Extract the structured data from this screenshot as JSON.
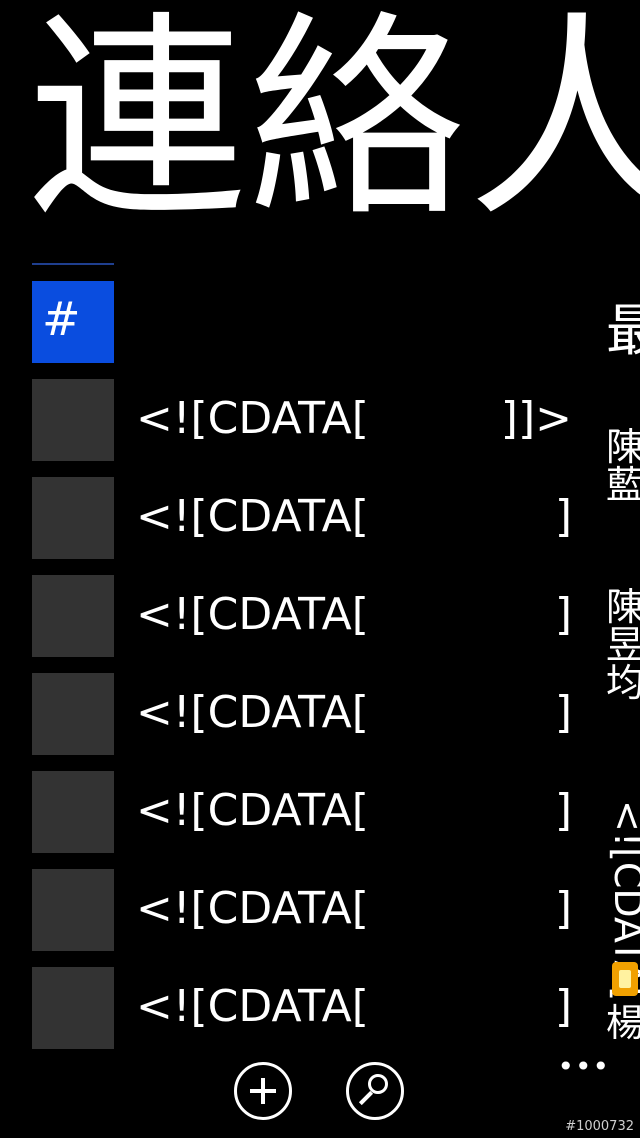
{
  "page": {
    "title": "連絡人"
  },
  "jump_list": {
    "header_tile": "#",
    "rows": [
      {
        "label": "<![CDATA[",
        "tail": "]]>"
      },
      {
        "label": "<![CDATA[",
        "tail": "]"
      },
      {
        "label": "<![CDATA[",
        "tail": "]"
      },
      {
        "label": "<![CDATA[",
        "tail": "]"
      },
      {
        "label": "<![CDATA[",
        "tail": "]"
      },
      {
        "label": "<![CDATA[",
        "tail": "]"
      },
      {
        "label": "<![CDATA[",
        "tail": "]"
      }
    ]
  },
  "next_pivot": {
    "heading_char": "最",
    "contact_1": "陳藍",
    "contact_2": "陳昱均",
    "contact_3_vertical": "<![CDATA[",
    "contact_3_after": "楊"
  },
  "app_bar": {
    "add_icon": "plus-circle-icon",
    "search_icon": "search-circle-icon",
    "more": "•••"
  },
  "watermark": "#1000732",
  "colors": {
    "accent": "#0a4ddf",
    "tile": "#333333",
    "background": "#000000"
  }
}
